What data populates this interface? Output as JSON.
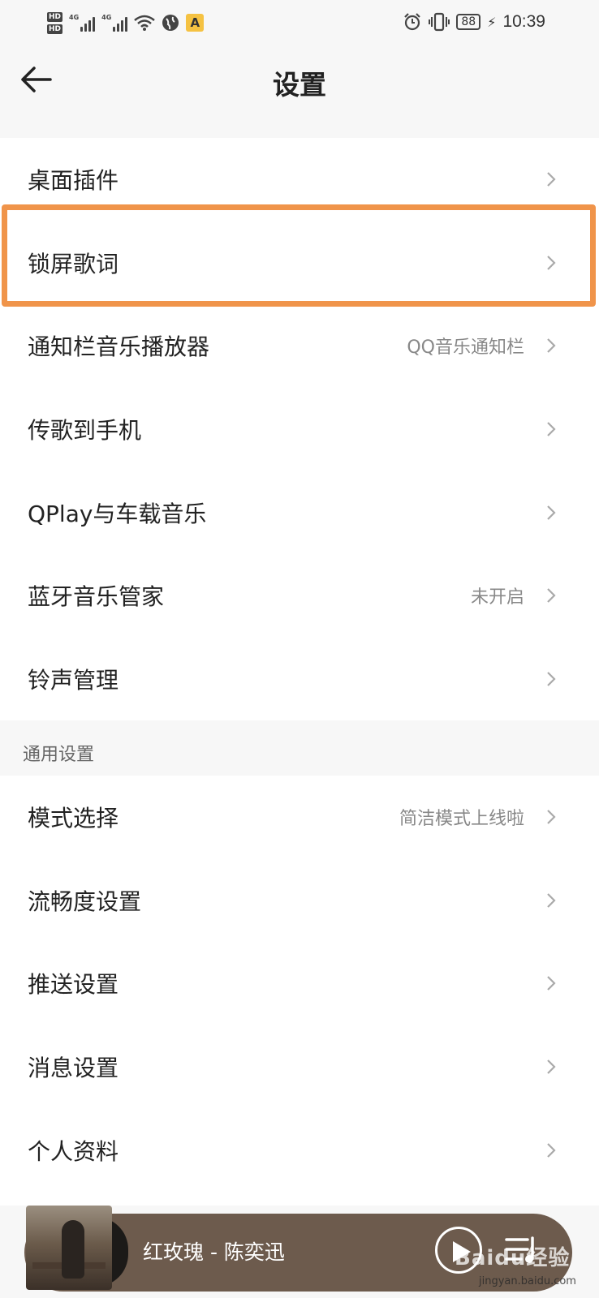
{
  "status_bar": {
    "hd1": "HD",
    "hd2": "HD",
    "net1": "4G",
    "net2": "4G",
    "battery": "88",
    "time": "10:39"
  },
  "header": {
    "title": "设置"
  },
  "settings": [
    {
      "label": "桌面插件",
      "value": ""
    },
    {
      "label": "锁屏歌词",
      "value": ""
    },
    {
      "label": "通知栏音乐播放器",
      "value": "QQ音乐通知栏"
    },
    {
      "label": "传歌到手机",
      "value": ""
    },
    {
      "label": "QPlay与车载音乐",
      "value": ""
    },
    {
      "label": "蓝牙音乐管家",
      "value": "未开启"
    },
    {
      "label": "铃声管理",
      "value": ""
    }
  ],
  "general": {
    "header": "通用设置",
    "items": [
      {
        "label": "模式选择",
        "value": "简洁模式上线啦"
      },
      {
        "label": "流畅度设置",
        "value": ""
      },
      {
        "label": "推送设置",
        "value": ""
      },
      {
        "label": "消息设置",
        "value": ""
      },
      {
        "label": "个人资料",
        "value": ""
      }
    ]
  },
  "player": {
    "song": "红玫瑰 - 陈奕迅"
  },
  "watermark": {
    "brand": "Baidu经验",
    "url": "jingyan.baidu.com"
  },
  "colors": {
    "highlight": "#f0944a",
    "player_bg": "#6d5b4d"
  }
}
